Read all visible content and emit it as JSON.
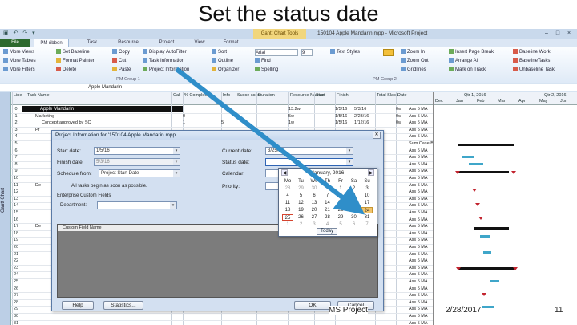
{
  "slide": {
    "title": "Set the status date",
    "footer_left": "MS Project",
    "footer_date": "2/28/2017",
    "footer_page": "11"
  },
  "window": {
    "context_tab": "Gantt Chart Tools",
    "title": "150104 Apple Mandarin.mpp - Microsoft Project",
    "controls": [
      "–",
      "□",
      "×"
    ],
    "quick_access": "▣ ↶ ↷ ▾"
  },
  "tabs": [
    "File",
    "PM ribbon",
    "Task",
    "Resource",
    "Project",
    "View",
    "Format"
  ],
  "ribbon": {
    "col1": [
      "More Views",
      "More Tables",
      "More Filters"
    ],
    "col2": [
      "Set Baseline",
      "Format Painter",
      "Delete"
    ],
    "col3": [
      "Copy",
      "Cut",
      "Paste"
    ],
    "col4": [
      "Display AutoFilter",
      "Task Information",
      "Project Information"
    ],
    "col5": [
      "Sort",
      "Outline",
      "Organizer"
    ],
    "col6": [
      "Arial",
      "Find",
      "Spelling"
    ],
    "col7": [
      "Text Styles",
      "Zoom In",
      "Zoom Out",
      "Gridlines"
    ],
    "col8": [
      "Insert Page Break",
      "Arrange All",
      "Mark on Track"
    ],
    "col9": [
      "Baseline Work",
      "BaselineTasks",
      "Unbaseline Task"
    ],
    "group1": "PM Group 1",
    "group2": "PM Group 2",
    "font_size": "9"
  },
  "entry_bar": {
    "value": "Apple Mandarin"
  },
  "side_label": "Gantt Chart",
  "grid": {
    "headers": [
      "Line",
      "Task Name",
      "Cal",
      "% Complete",
      "Info",
      "Succe ssors",
      "Duration",
      "Resource Names",
      "Start",
      "Finish",
      "Total Slack",
      "Date"
    ],
    "rows": [
      {
        "n": "0",
        "name": "Apple Mandarin",
        "dur": "13.2w",
        "start": "1/5/16",
        "finish": "5/3/16",
        "slack": "0w",
        "date": "Ass 5 MA"
      },
      {
        "n": "1",
        "name": "Marketing",
        "pct": "0",
        "dur": "5w",
        "start": "1/5/16",
        "finish": "2/23/16",
        "slack": "0w",
        "date": "Ass 5 MA"
      },
      {
        "n": "2",
        "name": "Concept approved by SC",
        "pct": "1",
        "info": "5",
        "dur": "1w",
        "start": "1/5/16",
        "finish": "1/12/16",
        "slack": "0w",
        "date": "Ass 5 MA"
      },
      {
        "n": "3",
        "name": "Pr",
        "date": "Ass 5 MA"
      },
      {
        "n": "4",
        "date": "Ass 5 MA"
      },
      {
        "n": "5",
        "date": "Sum Case BA"
      },
      {
        "n": "6",
        "date": "Ass 5 MA"
      },
      {
        "n": "7",
        "date": "Ass 5 MA"
      },
      {
        "n": "8",
        "date": "Ass 5 MA"
      },
      {
        "n": "9",
        "date": "Ass 5 MA"
      },
      {
        "n": "10",
        "date": "Ass 5 MA"
      },
      {
        "n": "11",
        "name": "De",
        "date": "Ass 5 MA"
      },
      {
        "n": "12",
        "date": "Ass 5 MA"
      },
      {
        "n": "13",
        "date": "Ass 5 MA"
      },
      {
        "n": "14",
        "date": "Ass 5 MA"
      },
      {
        "n": "15",
        "date": "Ass 5 MA"
      },
      {
        "n": "16",
        "date": "Ass 5 MA"
      },
      {
        "n": "17",
        "name": "De",
        "date": "Ass 5 MA"
      },
      {
        "n": "18",
        "date": "Ass 5 MA"
      },
      {
        "n": "19",
        "date": "Ass 5 MA"
      },
      {
        "n": "20",
        "date": "Ass 5 MA"
      },
      {
        "n": "21",
        "date": "Ass 5 MA"
      },
      {
        "n": "22",
        "date": "Ass 5 MA"
      },
      {
        "n": "23",
        "date": "Ass 5 MA"
      },
      {
        "n": "24",
        "date": "Ass 5 MA"
      },
      {
        "n": "25",
        "date": "Ass 5 MA"
      },
      {
        "n": "26",
        "date": "Ass 5 MA"
      },
      {
        "n": "27",
        "date": "Ass 5 MA"
      },
      {
        "n": "28",
        "date": "Ass 5 MA"
      },
      {
        "n": "29",
        "date": "Ass 5 MA"
      },
      {
        "n": "30",
        "date": "Ass 5 MA"
      },
      {
        "n": "31",
        "date": "Ass 5 MA"
      }
    ]
  },
  "gantt_header": {
    "top": [
      "Qtr 1, 2016",
      "Qtr 2, 2016"
    ],
    "months": [
      "Dec",
      "Jan",
      "Feb",
      "Mar",
      "Apr",
      "May",
      "Jun"
    ]
  },
  "dialog": {
    "title": "Project Information for '150104 Apple Mandarin.mpp'",
    "close": "✕",
    "start_date_label": "Start date:",
    "start_date": "1/5/16",
    "finish_date_label": "Finish date:",
    "finish_date": "5/3/16",
    "schedule_from_label": "Schedule from:",
    "schedule_from": "Project Start Date",
    "current_date_label": "Current date:",
    "current_date": "3/25/16",
    "status_date_label": "Status date:",
    "status_date": "",
    "calendar_label": "Calendar:",
    "calendar": "",
    "priority_label": "Priority:",
    "note": "All tasks begin as soon as possible.",
    "custom_fields_label": "Enterprise Custom Fields",
    "department_label": "Department:",
    "custom_field_name": "Custom Field Name",
    "help": "Help",
    "statistics": "Statistics...",
    "ok": "OK",
    "cancel": "Cancel"
  },
  "calendar": {
    "month": "January, 2016",
    "prev": "◀",
    "next": "▶",
    "weekdays": [
      "Mo",
      "Tu",
      "We",
      "Th",
      "Fr",
      "Sa",
      "Su"
    ],
    "weeks": [
      [
        "28",
        "29",
        "30",
        "31",
        "1",
        "2",
        "3"
      ],
      [
        "4",
        "5",
        "6",
        "7",
        "8",
        "9",
        "10"
      ],
      [
        "11",
        "12",
        "13",
        "14",
        "15",
        "16",
        "17"
      ],
      [
        "18",
        "19",
        "20",
        "21",
        "22",
        "23",
        "24"
      ],
      [
        "25",
        "26",
        "27",
        "28",
        "29",
        "30",
        "31"
      ],
      [
        "1",
        "2",
        "3",
        "4",
        "5",
        "6",
        "7"
      ]
    ],
    "selected": "24",
    "today_button": "Today"
  },
  "colors": {
    "arrow": "#2f8ec9",
    "summary": "#111111",
    "task_bar": "#3fa6c9",
    "milestone": "#c2232e",
    "file_tab": "#2d6a2e"
  }
}
